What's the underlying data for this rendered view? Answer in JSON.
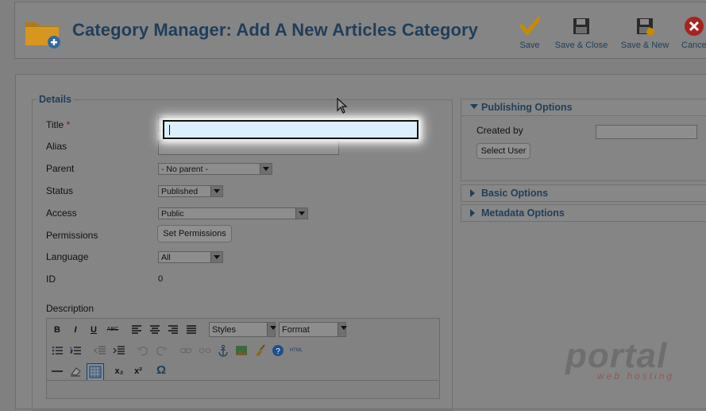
{
  "header": {
    "title": "Category Manager: Add A New Articles Category",
    "toolbar": [
      {
        "label": "Save",
        "icon": "check-icon"
      },
      {
        "label": "Save & Close",
        "icon": "floppy-disk-icon"
      },
      {
        "label": "Save & New",
        "icon": "floppy-disk-plus-icon"
      },
      {
        "label": "Cancel",
        "icon": "cancel-icon"
      }
    ]
  },
  "details": {
    "legend": "Details",
    "title_label": "Title",
    "required_mark": "*",
    "title_value": "",
    "alias_label": "Alias",
    "alias_value": "",
    "parent_label": "Parent",
    "parent_value": "- No parent -",
    "status_label": "Status",
    "status_value": "Published",
    "access_label": "Access",
    "access_value": "Public",
    "permissions_label": "Permissions",
    "permissions_button": "Set Permissions",
    "language_label": "Language",
    "language_value": "All",
    "id_label": "ID",
    "id_value": "0",
    "description_label": "Description"
  },
  "editor": {
    "styles_value": "Styles",
    "format_value": "Format",
    "bold": "B",
    "italic": "I",
    "underline": "U",
    "strike": "ABC",
    "subscript": "x₂",
    "superscript": "x²",
    "omega": "Ω",
    "html": "HTML"
  },
  "right": {
    "publishing_title": "Publishing Options",
    "created_by_label": "Created by",
    "created_by_value": "",
    "select_user_button": "Select User",
    "basic_title": "Basic Options",
    "metadata_title": "Metadata Options"
  },
  "watermark": {
    "text": "portal",
    "subtext": "web hosting"
  },
  "colors": {
    "heading": "#1f3e5c",
    "overlay_bg": "#808080",
    "highlight_field": "#dcefff",
    "save_check": "#e8a000",
    "cancel_red": "#d33"
  }
}
